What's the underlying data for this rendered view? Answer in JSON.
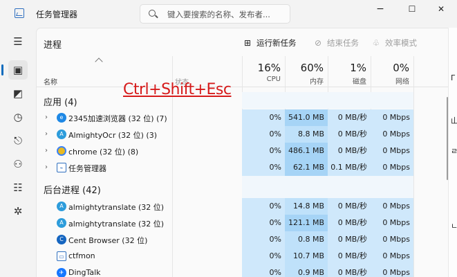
{
  "titlebar": {
    "title": "任务管理器",
    "search_placeholder": "键入要搜索的名称、发布者...",
    "minimize": "−",
    "maximize": "☐",
    "close": "✕"
  },
  "nav": {
    "menu": "☰",
    "processes": "▣",
    "performance": "◩",
    "history": "◷",
    "startup": "⎋",
    "users": "⚇",
    "details": "☷",
    "services": "✲"
  },
  "toolbar": {
    "page_title": "进程",
    "run_new_task": "运行新任务",
    "end_task": "结束任务",
    "efficiency_mode": "效率模式"
  },
  "columns": {
    "name": "名称",
    "status": "状态",
    "cpu": {
      "percent": "16%",
      "label": "CPU"
    },
    "memory": {
      "percent": "60%",
      "label": "内存"
    },
    "disk": {
      "percent": "1%",
      "label": "磁盘"
    },
    "network": {
      "percent": "0%",
      "label": "网络"
    }
  },
  "overlay_text": "Ctrl+Shift+Esc",
  "sections": {
    "apps": {
      "title": "应用 (4)",
      "rows": [
        {
          "name": "2345加速浏览器 (32 位) (7)",
          "cpu": "0%",
          "mem": "541.0 MB",
          "disk": "0 MB/秒",
          "net": "0 Mbps"
        },
        {
          "name": "AlmightyOcr (32 位) (3)",
          "cpu": "0%",
          "mem": "8.8 MB",
          "disk": "0 MB/秒",
          "net": "0 Mbps"
        },
        {
          "name": "chrome (32 位) (8)",
          "cpu": "0%",
          "mem": "486.1 MB",
          "disk": "0 MB/秒",
          "net": "0 Mbps"
        },
        {
          "name": "任务管理器",
          "cpu": "0%",
          "mem": "62.1 MB",
          "disk": "0.1 MB/秒",
          "net": "0 Mbps"
        }
      ]
    },
    "background": {
      "title": "后台进程 (42)",
      "rows": [
        {
          "name": "almightytranslate (32 位)",
          "cpu": "0%",
          "mem": "14.8 MB",
          "disk": "0 MB/秒",
          "net": "0 Mbps"
        },
        {
          "name": "almightytranslate (32 位)",
          "cpu": "0%",
          "mem": "121.1 MB",
          "disk": "0 MB/秒",
          "net": "0 Mbps"
        },
        {
          "name": "Cent Browser (32 位)",
          "cpu": "0%",
          "mem": "0.8 MB",
          "disk": "0 MB/秒",
          "net": "0 Mbps"
        },
        {
          "name": "ctfmon",
          "cpu": "0%",
          "mem": "10.7 MB",
          "disk": "0 MB/秒",
          "net": "0 Mbps"
        },
        {
          "name": "DingTalk",
          "cpu": "0%",
          "mem": "0.9 MB",
          "disk": "0 MB/秒",
          "net": "0 Mbps"
        }
      ]
    }
  },
  "side_glyphs": [
    "Г",
    "山",
    "ㄹ",
    "ㄴ"
  ]
}
